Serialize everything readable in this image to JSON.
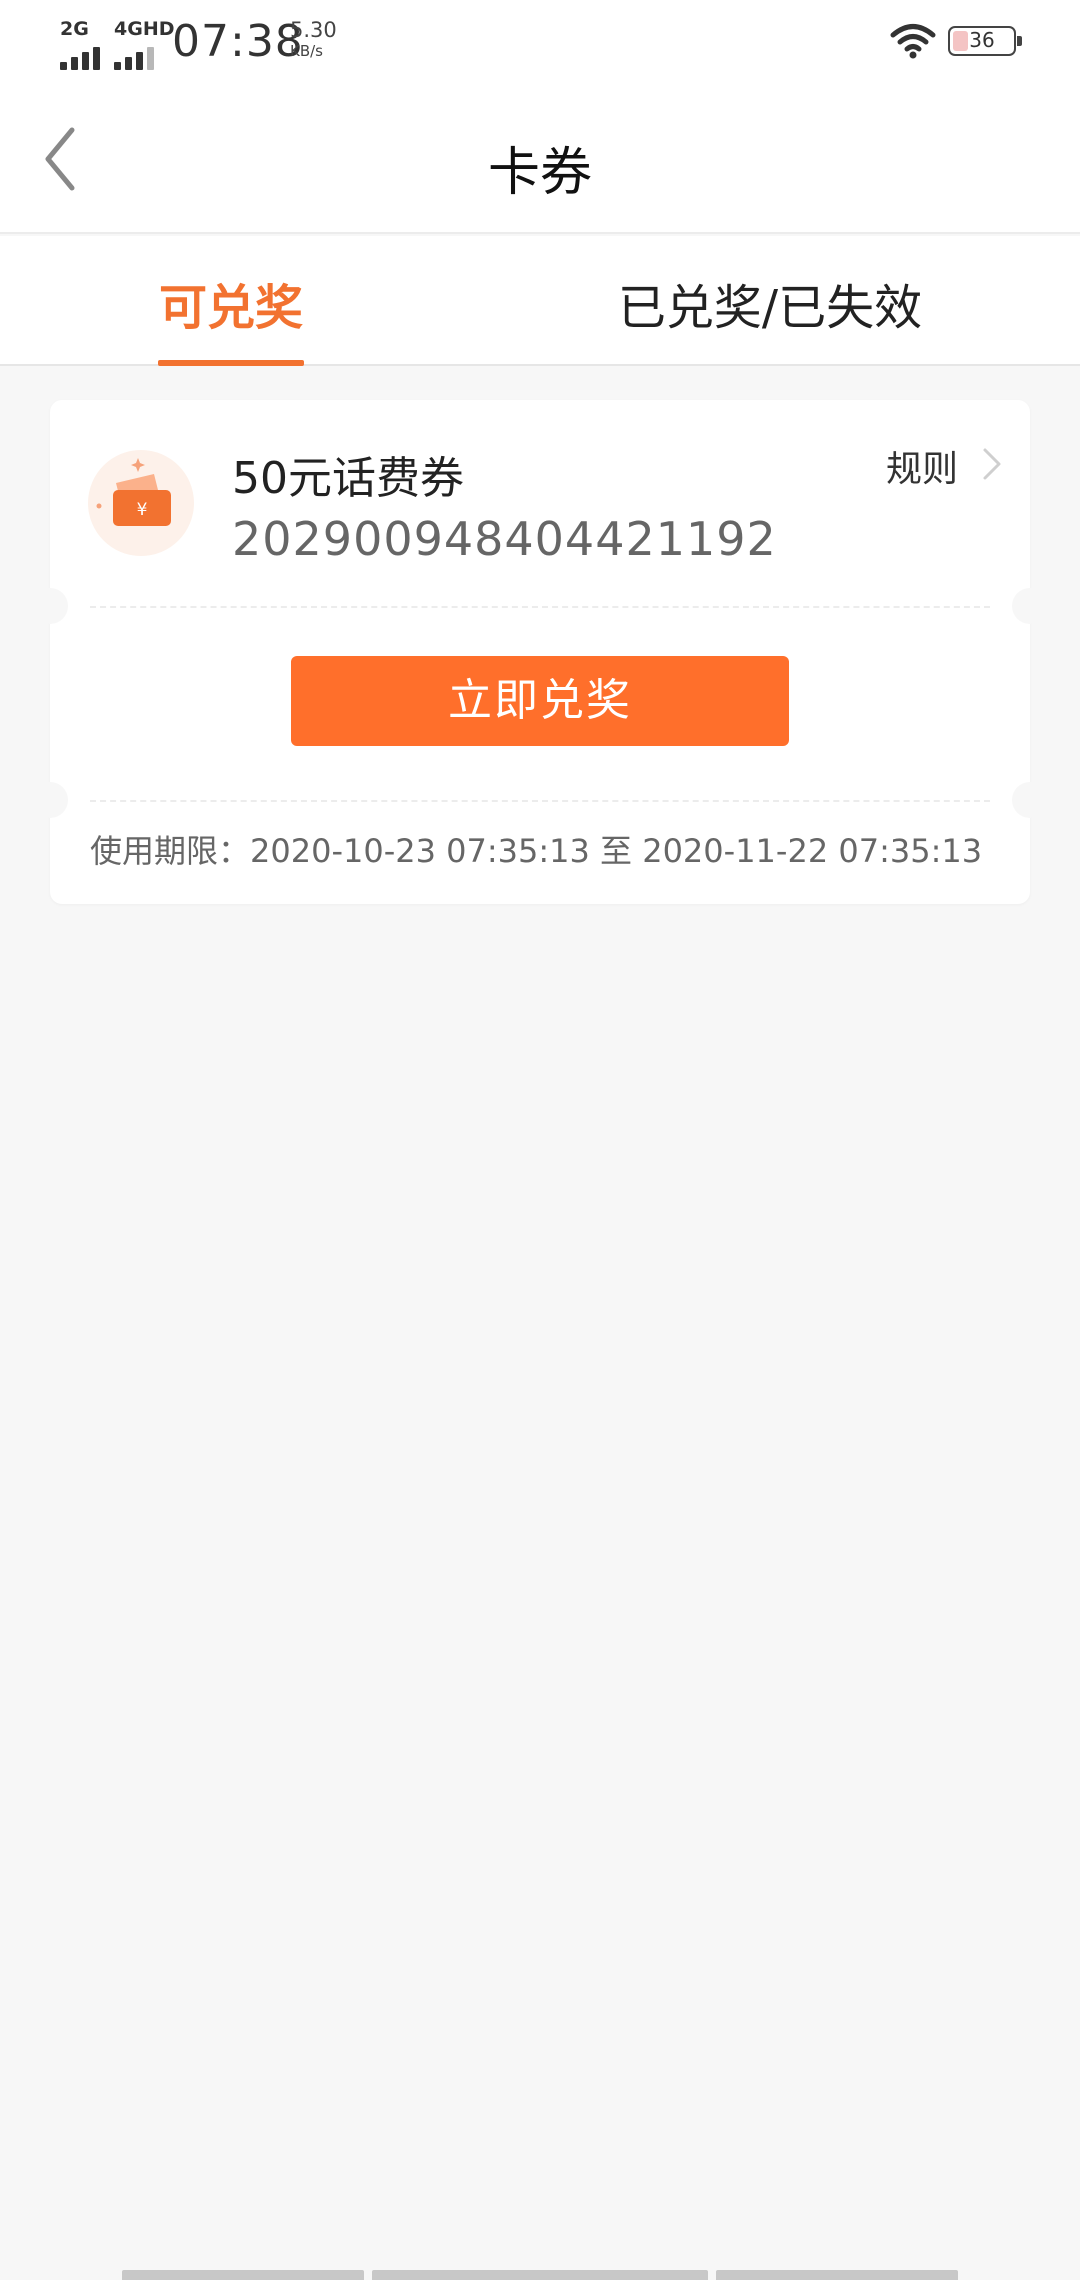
{
  "status_bar": {
    "sim1_label": "2G",
    "sim2_label": "4GHD",
    "time": "07:38",
    "net_rate": "5.30",
    "net_unit": "KB/s",
    "battery_level": "36",
    "wifi_icon": "wifi-icon",
    "battery_icon": "battery-icon"
  },
  "header": {
    "title": "卡券",
    "back_icon": "chevron-left-icon"
  },
  "tabs": [
    {
      "label": "可兑奖",
      "active": true
    },
    {
      "label": "已兑奖/已失效",
      "active": false
    }
  ],
  "coupon": {
    "icon": "coupon-ticket-icon",
    "name": "50元话费券",
    "code": "202900948404421192",
    "rules_label": "规则",
    "redeem_label": "立即兑奖",
    "validity_text": "使用期限：2020-10-23 07:35:13 至 2020-11-22 07:35:13"
  },
  "colors": {
    "accent": "#f27230",
    "button": "#ff6f2b",
    "background": "#f7f7f7"
  }
}
